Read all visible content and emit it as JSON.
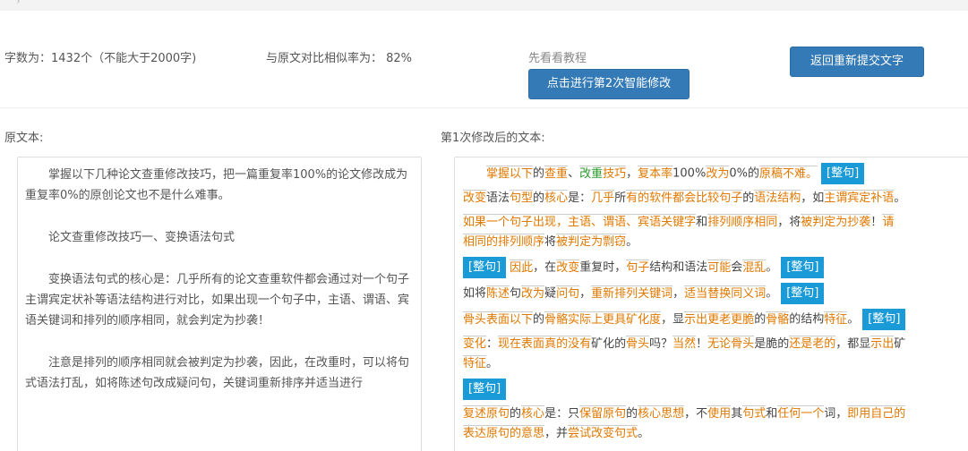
{
  "header": {
    "crumb": "›"
  },
  "stats": {
    "word_count": "字数为：1432个（不能大于2000字)",
    "similarity": "与原文对比相似率为： 82%"
  },
  "actions": {
    "tutorial_link": "先看看教程",
    "modify_button": "点击进行第2次智能修改",
    "back_button": "返回重新提交文字"
  },
  "original": {
    "label": "原文本:",
    "paragraphs": [
      "掌握以下几种论文查重修改技巧，把一篇重复率100%的论文修改成为重复率0%的原创论文也不是什么难事。",
      "论文查重修改技巧一、变换语法句式",
      "变换语法句式的核心是：几乎所有的论文查重软件都会通过对一个句子主谓宾定状补等语法结构进行对比，如果出现一个句子中，主语、谓语、宾语关键词和排列的顺序相同，就会判定为抄袭！",
      "注意是排列的顺序相同就会被判定为抄袭，因此，在改重时，可以将句式语法打乱，如将陈述句改成疑问句，关键词重新排序并适当进行"
    ]
  },
  "modified": {
    "label": "第1次修改后的文本:",
    "tag_label": "[整句]",
    "lines": {
      "l1": [
        "掌握",
        "以下",
        "的",
        "查重",
        "、",
        "改重",
        "技巧",
        "，",
        "复本率",
        "100%",
        "改为",
        "0%的",
        "原稿",
        "不难",
        "。"
      ],
      "l2": [
        "改变",
        "语法",
        "句型",
        "的",
        "核心",
        "是：",
        "几乎",
        "所",
        "有的",
        "软件",
        "都会",
        "比较",
        "句子",
        "的",
        "语法结构",
        "，如",
        "主谓",
        "宾定",
        "补语",
        "。"
      ],
      "l3": [
        "如果",
        "一个",
        "句子",
        "出现",
        "，",
        "主语",
        "、",
        "谓语",
        "、",
        "宾语",
        "关键字",
        "和",
        "排列",
        "顺序",
        "相同",
        "，将",
        "被判",
        "定为",
        "抄袭",
        "！",
        "请"
      ],
      "l4": [
        "相同的",
        "排列",
        "顺序",
        "将",
        "被判",
        "定为",
        "剽窃",
        "。"
      ],
      "l5": [
        "因此",
        "，在",
        "改变",
        "重复时，",
        "句子",
        "结构和语法",
        "可能",
        "会",
        "混乱",
        "。"
      ],
      "l6": [
        "如将",
        "陈述",
        "句",
        "改为",
        "疑",
        "问句",
        "，",
        "重新",
        "排列",
        "关键词",
        "，",
        "适当",
        "替换",
        "同义词",
        "。"
      ],
      "l7": [
        "骨头",
        "表面",
        "以下",
        "的",
        "骨骼",
        "实际上",
        "更具",
        "矿化度",
        "，显",
        "示出",
        "更老",
        "更脆",
        "的",
        "骨骼",
        "的结构",
        "特征",
        "。"
      ],
      "l8": [
        "变化",
        "：",
        "现在",
        "表面",
        "真的",
        "没有",
        "矿化的",
        "骨头",
        "吗？",
        "当然",
        "！",
        "无论",
        "骨头",
        "是脆的",
        "还是",
        "老的",
        "，都显",
        "示出",
        "矿"
      ],
      "l9": [
        "特征",
        "。"
      ],
      "l10": [
        "复述",
        "原句",
        "的",
        "核心",
        "是：只",
        "保留",
        "原句",
        "的",
        "核心",
        "思想",
        "，不",
        "使用",
        "其",
        "句式",
        "和",
        "任何",
        "一个",
        "词，",
        "即用",
        "自己的"
      ],
      "l11": [
        "表达",
        "原句",
        "的意思",
        "，并",
        "尝试",
        "改变",
        "句式",
        "。"
      ]
    }
  },
  "colors": {
    "button_blue": "#337ab7",
    "tag_blue": "#1a9bd7",
    "changed_orange": "#e07800",
    "changed_green": "#2c9a2c"
  }
}
